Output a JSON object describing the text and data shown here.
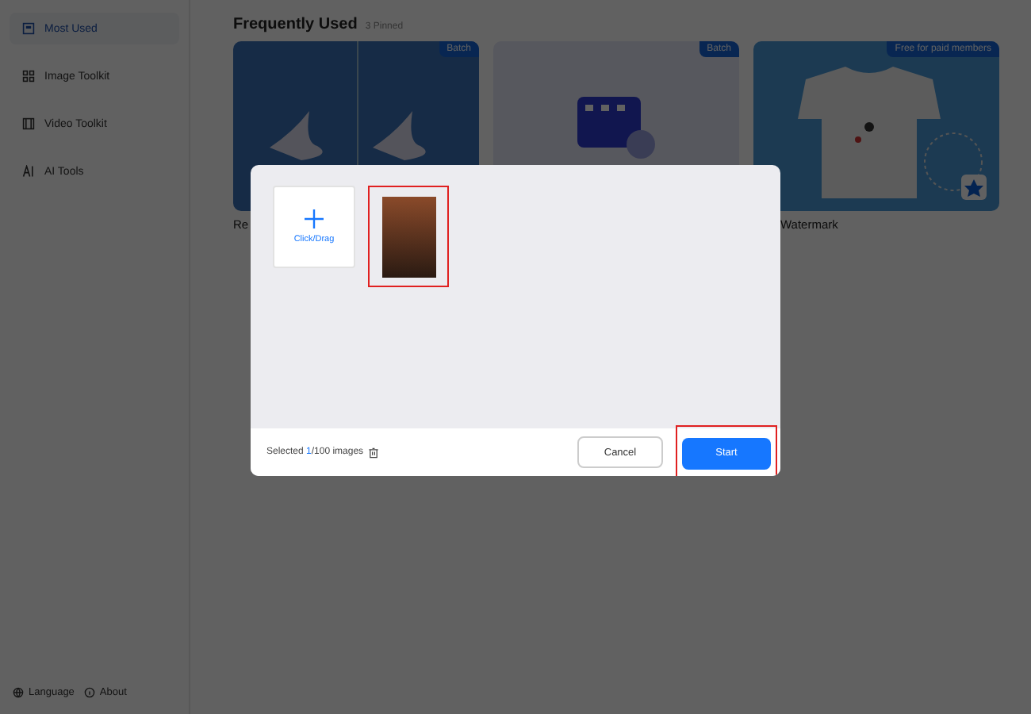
{
  "sidebar": {
    "items": [
      {
        "label": "Most Used",
        "kind": "square",
        "selected": true
      },
      {
        "label": "Image Toolkit",
        "kind": "grid",
        "selected": false
      },
      {
        "label": "Video Toolkit",
        "kind": "film",
        "selected": false
      },
      {
        "label": "AI Tools",
        "kind": "ai",
        "selected": false
      }
    ],
    "footer": [
      {
        "label": "Language",
        "kind": "globe"
      },
      {
        "label": "About",
        "kind": "info"
      }
    ]
  },
  "main": {
    "title": "Frequently Used",
    "pinned": "3 Pinned",
    "cards": [
      {
        "kind": "bird",
        "badge": "Batch",
        "label": "Re"
      },
      {
        "kind": "video",
        "badge": "Batch"
      },
      {
        "kind": "shirt",
        "badge": "Free for paid members",
        "label": "Watermark"
      }
    ]
  },
  "dialog": {
    "add_tile": {
      "label": "Click/Drag"
    },
    "images": [
      {
        "highlighted": true
      }
    ],
    "status": {
      "prefix": "Selected ",
      "count": "1",
      "suffix": "/100 images"
    },
    "cancel": "Cancel",
    "start": {
      "label": "Start",
      "highlighted": true
    }
  }
}
